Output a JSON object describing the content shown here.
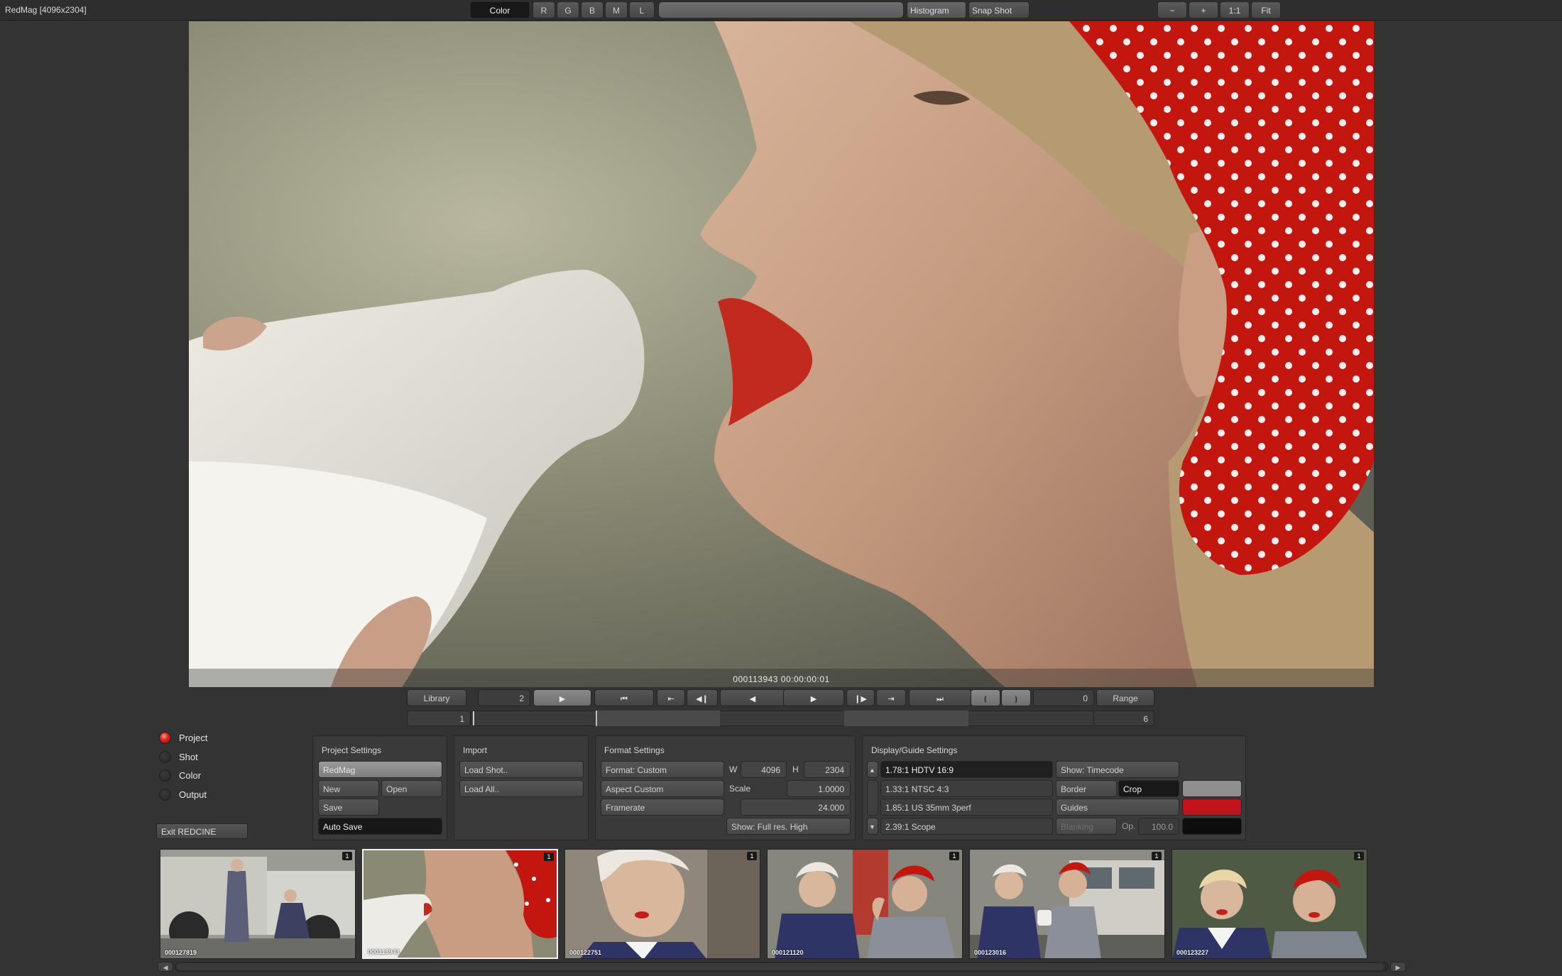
{
  "window": {
    "title": "RedMag [4096x2304]"
  },
  "toolbar": {
    "color_label": "Color",
    "channels": [
      "R",
      "G",
      "B",
      "M",
      "L"
    ],
    "histogram_label": "Histogram",
    "snapshot_label": "Snap Shot",
    "zoom_out": "−",
    "zoom_in": "+",
    "zoom_one": "1:1",
    "fit_label": "Fit"
  },
  "viewer": {
    "timecode": "000113943 00:00:00:01"
  },
  "transport": {
    "library_label": "Library",
    "clip_number": "2",
    "frame_in": "0",
    "range_label": "Range",
    "timeline_start": "1",
    "timeline_end": "6"
  },
  "nav": {
    "items": [
      {
        "label": "Project",
        "selected": true
      },
      {
        "label": "Shot",
        "selected": false
      },
      {
        "label": "Color",
        "selected": false
      },
      {
        "label": "Output",
        "selected": false
      }
    ],
    "exit_label": "Exit REDCINE"
  },
  "project_settings": {
    "title": "Project Settings",
    "project_name": "RedMag",
    "new_label": "New",
    "open_label": "Open",
    "save_label": "Save",
    "autosave_label": "Auto Save"
  },
  "import": {
    "title": "Import",
    "load_shot": "Load Shot..",
    "load_all": "Load All.."
  },
  "format_settings": {
    "title": "Format Settings",
    "format": "Format: Custom",
    "aspect": "Aspect Custom",
    "framerate_label": "Framerate",
    "w_label": "W",
    "w_value": "4096",
    "h_label": "H",
    "h_value": "2304",
    "scale_label": "Scale",
    "scale_value": "1.0000",
    "framerate_value": "24.000",
    "show_label": "Show: Full res. High"
  },
  "display_guide": {
    "title": "Display/Guide Settings",
    "ratios": [
      "1.78:1 HDTV 16:9",
      "1.33:1 NTSC 4:3",
      "1.85:1 US 35mm 3perf",
      "2.39:1 Scope"
    ],
    "show_label": "Show: Timecode",
    "border_label": "Border",
    "crop_label": "Crop",
    "guides_label": "Guides",
    "blanking_label": "Blanking",
    "op_label": "Op.",
    "op_value": "100.0",
    "border_color": "#8f8f8f",
    "guides_color": "#c0141a",
    "blanking_color": "#0d0d0d"
  },
  "thumbnails": [
    {
      "id": "000127819",
      "badge": "1"
    },
    {
      "id": "000113943",
      "badge": "1"
    },
    {
      "id": "000122751",
      "badge": "1"
    },
    {
      "id": "000121120",
      "badge": "1"
    },
    {
      "id": "000123016",
      "badge": "1"
    },
    {
      "id": "000123227",
      "badge": "1"
    }
  ],
  "scrollbar": {
    "left_arrow": "◀",
    "right_arrow": "▶"
  }
}
